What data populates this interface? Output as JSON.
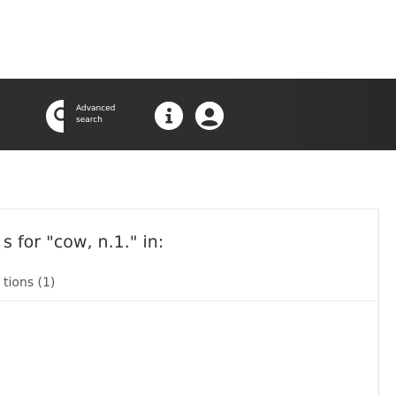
{
  "header": {
    "search_icon": "search-icon",
    "advanced_search": {
      "line1": "Advanced",
      "line2": "search"
    },
    "info_icon": "info-icon",
    "user_icon": "user-icon",
    "colors": {
      "background": "#2e2e2e",
      "icon_fill": "#ffffff"
    }
  },
  "main": {
    "title": "s for \"cow, n.1.\" in:",
    "section": "tions (1)"
  }
}
